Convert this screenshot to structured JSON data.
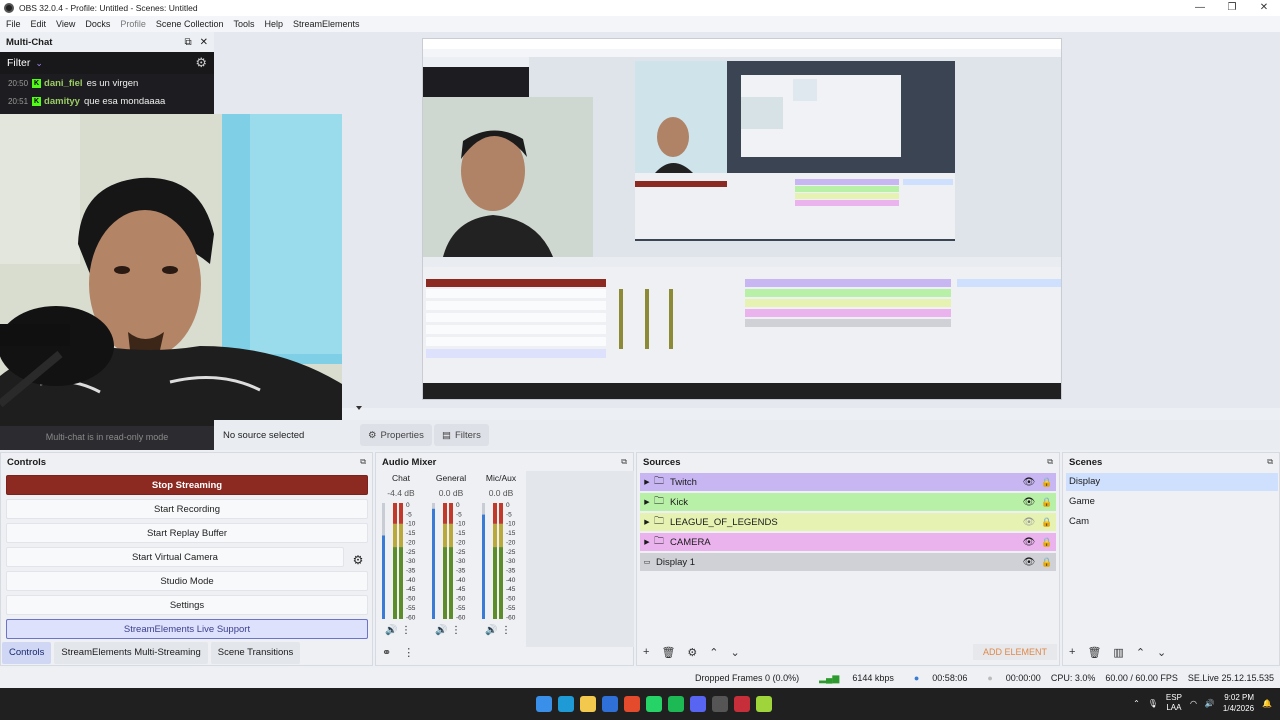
{
  "window": {
    "title": "OBS 32.0.4 - Profile: Untitled - Scenes: Untitled",
    "controls": [
      "—",
      "❐",
      "✕"
    ]
  },
  "menu": [
    "File",
    "Edit",
    "View",
    "Docks",
    "Profile",
    "Scene Collection",
    "Tools",
    "Help",
    "StreamElements"
  ],
  "multichat": {
    "title": "Multi-Chat",
    "filter_label": "Filter",
    "messages": [
      {
        "time": "20:50",
        "user": "dani_fiel",
        "text": "es un virgen"
      },
      {
        "time": "20:51",
        "user": "damityy",
        "text": "que esa mondaaaa"
      }
    ],
    "footer": "Multi-chat is in read-only mode"
  },
  "preview": {
    "no_source": "No source selected",
    "properties_label": "Properties",
    "filters_label": "Filters"
  },
  "controls": {
    "title": "Controls",
    "buttons": [
      "Stop Streaming",
      "Start Recording",
      "Start Replay Buffer",
      "Start Virtual Camera",
      "Studio Mode",
      "Settings",
      "StreamElements Live Support"
    ]
  },
  "tabs": [
    "Controls",
    "StreamElements Multi-Streaming",
    "Scene Transitions"
  ],
  "audio_mixer": {
    "title": "Audio Mixer",
    "channels": [
      {
        "name": "Chat",
        "db": "-4.4 dB",
        "level": 0.72
      },
      {
        "name": "General",
        "db": "0.0 dB",
        "level": 0.95
      },
      {
        "name": "Mic/Aux",
        "db": "0.0 dB",
        "level": 0.9
      }
    ],
    "scale": [
      "0",
      "-5",
      "-10",
      "-15",
      "-20",
      "-25",
      "-30",
      "-35",
      "-40",
      "-45",
      "-50",
      "-55",
      "-60"
    ]
  },
  "sources": {
    "title": "Sources",
    "items": [
      {
        "label": "Twitch",
        "color": "#c8b6f2",
        "group": true
      },
      {
        "label": "Kick",
        "color": "#b9f0a8",
        "group": true
      },
      {
        "label": "LEAGUE_OF_LEGENDS",
        "color": "#e6f2b2",
        "group": true
      },
      {
        "label": "CAMERA",
        "color": "#eab3ee",
        "group": true
      },
      {
        "label": "Display 1",
        "color": "#cfd1d6",
        "group": false
      }
    ],
    "add_element": "ADD ELEMENT"
  },
  "scenes": {
    "title": "Scenes",
    "items": [
      "Display",
      "Game",
      "Cam"
    ]
  },
  "status": {
    "dropped": "Dropped Frames 0 (0.0%)",
    "kbps": "6144 kbps",
    "stream_time": "00:58:06",
    "rec_time": "00:00:00",
    "cpu": "CPU: 3.0%",
    "fps": "60.00 / 60.00 FPS",
    "version": "SE.Live 25.12.15.535"
  },
  "taskbar": {
    "lang": "ESP",
    "region": "LAA",
    "time": "9:02 PM",
    "date": "1/4/2026"
  }
}
